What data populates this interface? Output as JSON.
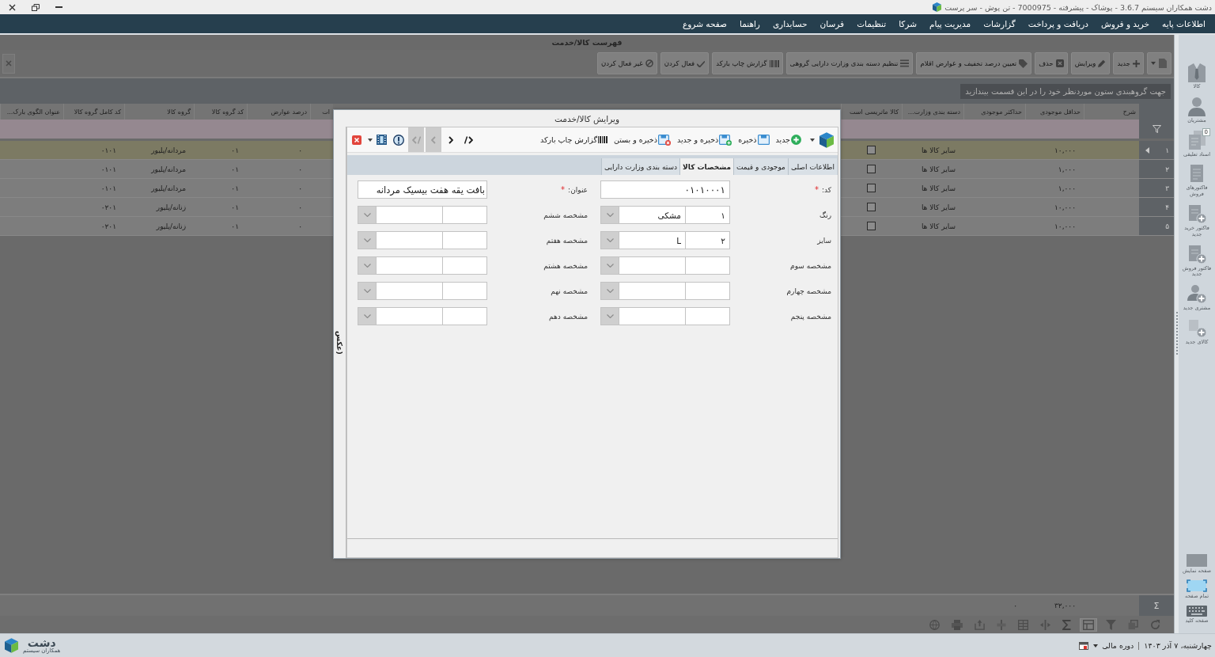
{
  "window": {
    "title": "دشت همکاران سیستم 3.6.7 - پوشاک - پیشرفته - 7000975 - تن پوش - سر پرست"
  },
  "menu": [
    "اطلاعات پایه",
    "خرید و فروش",
    "دریافت و پرداخت",
    "گزارشات",
    "مدیریت پیام",
    "شرکا",
    "تنظیمات",
    "فرسان",
    "حسابداری",
    "راهنما",
    "صفحه شروع"
  ],
  "list_view": {
    "title": "فهرست کالا/خدمت",
    "toolbar": [
      {
        "kind": "menu"
      },
      {
        "kind": "new",
        "label": "جدید"
      },
      {
        "kind": "edit",
        "label": "ویرایش"
      },
      {
        "kind": "delete",
        "label": "حذف"
      },
      {
        "kind": "discount",
        "label": "تعیین درصد تخفیف و عوارض اقلام"
      },
      {
        "kind": "category",
        "label": "تنظیم دسته بندی وزارت دارایی گروهی"
      },
      {
        "kind": "barcode",
        "label": "گزارش چاپ بارکد"
      },
      {
        "kind": "activate",
        "label": "فعال کردن"
      },
      {
        "kind": "deactivate",
        "label": "غیر فعال کردن"
      }
    ],
    "group_hint": "جهت گروهبندی ستون موردنظر خود را در این قسمت بیندازید",
    "columns": [
      {
        "label": "شرح",
        "kind": "text"
      },
      {
        "label": "حداقل موجودی",
        "kind": "text"
      },
      {
        "label": "حداکثر موجودی",
        "kind": "text"
      },
      {
        "label": "دسته بندی وزارت...",
        "kind": "text"
      },
      {
        "label": "کالا ماتریسی است",
        "kind": "check"
      },
      {
        "label": "ات",
        "kind": "text"
      },
      {
        "label": "درصد عوارض",
        "kind": "text"
      },
      {
        "label": "کد گروه کالا",
        "kind": "text"
      },
      {
        "label": "گروه کالا",
        "kind": "text"
      },
      {
        "label": "کد کامل گروه کالا",
        "kind": "text"
      },
      {
        "label": "عنوان الگوی بارک...",
        "kind": "text"
      }
    ],
    "rows": [
      {
        "number": "۱",
        "selected": true,
        "cells": [
          null,
          "۱۰,۰۰۰",
          null,
          "سایر کالا ها",
          {
            "checked": false
          },
          null,
          "۰",
          "۰۱",
          "مردانه/پلیور",
          "۰۱۰۱",
          null
        ]
      },
      {
        "number": "۲",
        "selected": false,
        "cells": [
          null,
          "۱,۰۰۰",
          null,
          "سایر کالا ها",
          {
            "checked": false
          },
          null,
          "۰",
          "۰۱",
          "مردانه/پلیور",
          "۰۱۰۱",
          null
        ]
      },
      {
        "number": "۳",
        "selected": false,
        "cells": [
          null,
          "۱,۰۰۰",
          null,
          "سایر کالا ها",
          {
            "checked": false
          },
          null,
          "۰",
          "۰۱",
          "مردانه/پلیور",
          "۰۱۰۱",
          null
        ]
      },
      {
        "number": "۴",
        "selected": false,
        "cells": [
          null,
          "۱۰,۰۰۰",
          null,
          "سایر کالا ها",
          {
            "checked": false
          },
          null,
          "۰",
          "۰۱",
          "زنانه/پلیور",
          "۰۲۰۱",
          null
        ]
      },
      {
        "number": "۵",
        "selected": false,
        "cells": [
          null,
          "۱۰,۰۰۰",
          null,
          "سایر کالا ها",
          {
            "checked": false
          },
          null,
          "۰",
          "۰۱",
          "زنانه/پلیور",
          "۰۲۰۱",
          null
        ]
      }
    ],
    "summary": {
      "label": "Σ",
      "cells": [
        null,
        "۳۲,۰۰۰",
        "۰"
      ]
    },
    "bottom_toolbar": [
      {
        "kind": "refresh",
        "selected": false
      },
      {
        "kind": "copy",
        "selected": false
      },
      {
        "kind": "filter",
        "selected": false
      },
      {
        "kind": "layout",
        "selected": true
      },
      {
        "kind": "sum",
        "selected": false
      },
      {
        "kind": "fit",
        "selected": false
      },
      {
        "kind": "grid",
        "selected": false
      },
      {
        "kind": "columns",
        "selected": false
      },
      {
        "kind": "export",
        "selected": false
      },
      {
        "kind": "print",
        "selected": false
      },
      {
        "kind": "globe",
        "selected": false
      }
    ]
  },
  "dialog": {
    "title": "ویرایش کالا/خدمت",
    "toolbar": [
      {
        "kind": "new",
        "label": "جدید"
      },
      {
        "kind": "save",
        "label": "ذخیره"
      },
      {
        "kind": "save_new",
        "label": "ذخیره و جدید"
      },
      {
        "kind": "save_close",
        "label": "ذخیره و بستن"
      },
      {
        "kind": "barcode",
        "label": "گزارش چاپ بارکد"
      }
    ],
    "navigation": [
      {
        "kind": "last",
        "disabled": false
      },
      {
        "kind": "next",
        "disabled": false
      },
      {
        "kind": "previous",
        "disabled": true
      },
      {
        "kind": "first",
        "disabled": true
      }
    ],
    "tabs": [
      {
        "label": "اطلاعات اصلی",
        "selected": false
      },
      {
        "label": "موجودی و قیمت",
        "selected": false
      },
      {
        "label": "مشخصات کالا",
        "selected": true
      },
      {
        "label": "دسته بندی وزارت دارایی",
        "selected": false
      }
    ],
    "fields": [
      {
        "label": "کد:",
        "mark": "*",
        "kind": "text",
        "value": "۰۱۰۱۰۰۰۱"
      },
      {
        "label": "عنوان:",
        "mark": "*",
        "kind": "text",
        "value": "بافت یقه هفت بیسیک مردانه"
      },
      {
        "label": "رنگ",
        "kind": "lookup",
        "code": "۱",
        "value": "مشکی"
      },
      {
        "label": "مشخصه ششم",
        "kind": "lookup"
      },
      {
        "label": "سایز",
        "kind": "lookup",
        "code": "۲",
        "value": "L"
      },
      {
        "label": "مشخصه هفتم",
        "kind": "lookup"
      },
      {
        "label": "مشخصه سوم",
        "kind": "lookup"
      },
      {
        "label": "مشخصه هشتم",
        "kind": "lookup"
      },
      {
        "label": "مشخصه چهارم",
        "kind": "lookup"
      },
      {
        "label": "مشخصه نهم",
        "kind": "lookup"
      },
      {
        "label": "مشخصه پنجم",
        "kind": "lookup"
      },
      {
        "label": "مشخصه دهم",
        "kind": "lookup"
      }
    ],
    "side_tab": "عکس)"
  },
  "sidebar": {
    "items": [
      {
        "kind": "product",
        "label": "کالا"
      },
      {
        "kind": "customers",
        "label": "مشتریان"
      },
      {
        "kind": "pending",
        "label": "اسناد تعلیقی",
        "badge": "0"
      },
      {
        "kind": "sales_invoices",
        "label": "فاکتورهای فروش"
      },
      {
        "kind": "new_purchase",
        "label": "فاکتور خرید جدید"
      },
      {
        "kind": "new_sale",
        "label": "فاکتور فروش جدید"
      },
      {
        "kind": "new_customer",
        "label": "مشتری جدید"
      },
      {
        "kind": "new_product",
        "label": "کالای جدید"
      }
    ],
    "bottom_items": [
      {
        "kind": "display",
        "label": "صفحه نمایش"
      },
      {
        "kind": "fullscreen",
        "label": "تمام صفحه"
      },
      {
        "kind": "keyboard",
        "label": "صفحه کلید"
      }
    ]
  },
  "status_bar": {
    "date": "چهارشنبه، ۷ آذر ۱۴۰۳",
    "period_label": "دوره مالی",
    "brand": "دشت",
    "brand_subtitle": "همکاران سیستم"
  }
}
